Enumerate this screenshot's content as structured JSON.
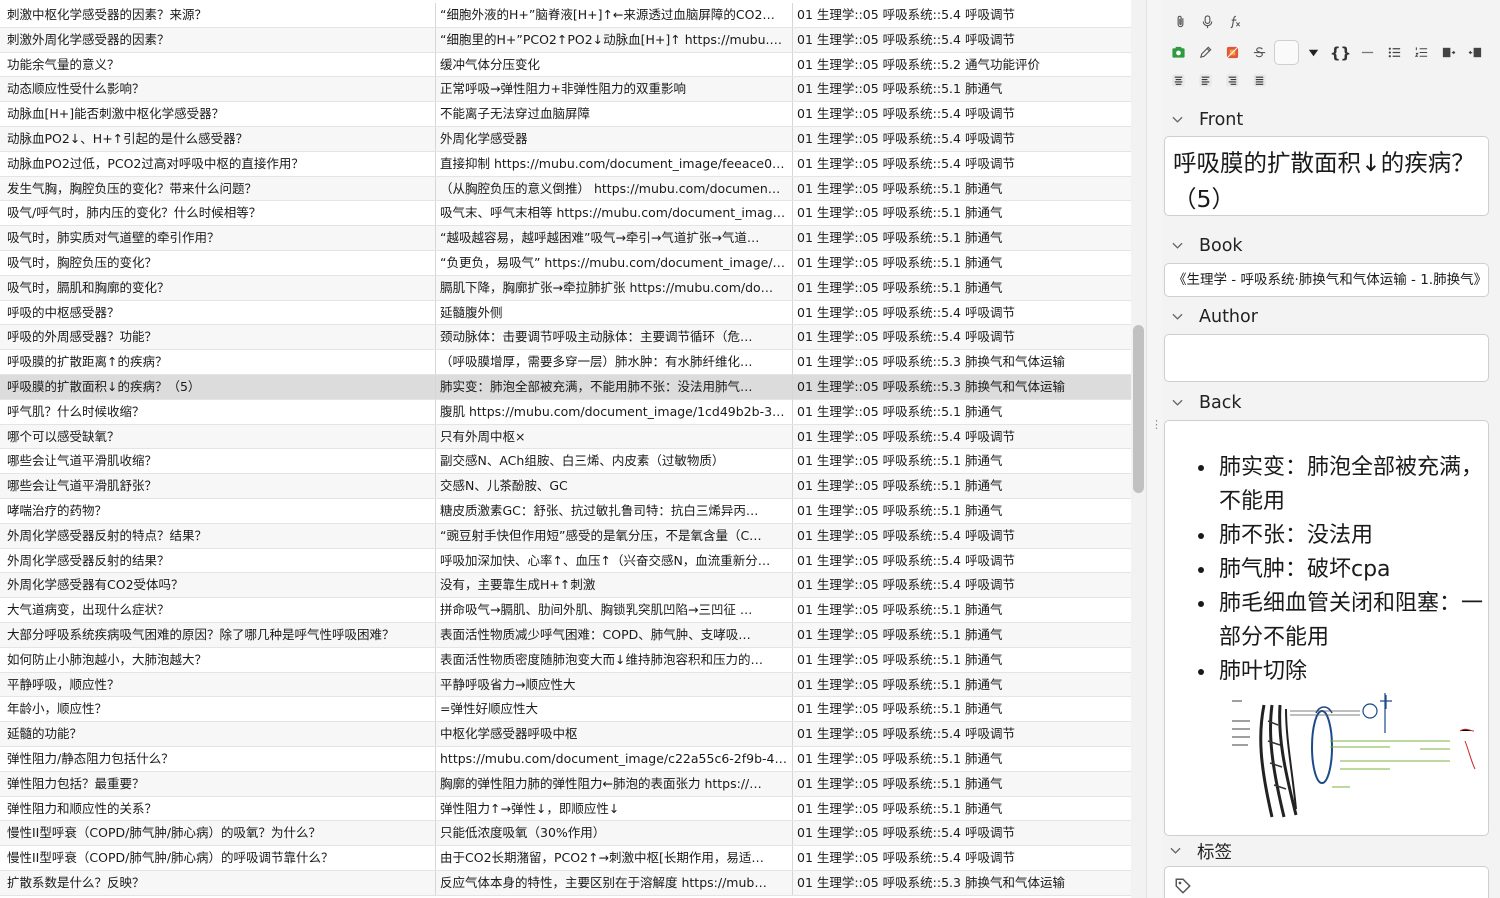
{
  "table": {
    "rows": [
      {
        "question": "刺激中枢化学感受器的因素？来源？",
        "answer": "“细胞外液的H+”脑脊液[H+]↑←来源透过血脑屏障的CO2…",
        "deck": "01 生理学::05 呼吸系统::5.4 呼吸调节"
      },
      {
        "question": "刺激外周化学感受器的因素？",
        "answer": "“细胞里的H+”PCO2↑PO2↓动脉血[H+]↑  https://mubu.co…",
        "deck": "01 生理学::05 呼吸系统::5.4 呼吸调节"
      },
      {
        "question": "功能余气量的意义？",
        "answer": "缓冲气体分压变化",
        "deck": "01 生理学::05 呼吸系统::5.2 通气功能评价"
      },
      {
        "question": "动态顺应性受什么影响？",
        "answer": "正常呼吸→弹性阻力+非弹性阻力的双重影响",
        "deck": "01 生理学::05 呼吸系统::5.1 肺通气"
      },
      {
        "question": "动脉血[H+]能否刺激中枢化学感受器？",
        "answer": "不能离子无法穿过血脑屏障",
        "deck": "01 生理学::05 呼吸系统::5.4 呼吸调节"
      },
      {
        "question": "动脉血PO2↓、H+↑引起的是什么感受器？",
        "answer": "外周化学感受器",
        "deck": "01 生理学::05 呼吸系统::5.4 呼吸调节"
      },
      {
        "question": "动脉血PO2过低，PCO2过高对呼吸中枢的直接作用？",
        "answer": "直接抑制  https://mubu.com/document_image/feeace02…",
        "deck": "01 生理学::05 呼吸系统::5.4 呼吸调节"
      },
      {
        "question": "发生气胸，胸腔负压的变化？带来什么问题？",
        "answer": "（从胸腔负压的意义倒推）  https://mubu.com/documen…",
        "deck": "01 生理学::05 呼吸系统::5.1 肺通气"
      },
      {
        "question": "吸气/呼气时，肺内压的变化？什么时候相等？",
        "answer": "吸气末、呼气末相等  https://mubu.com/document_imag…",
        "deck": "01 生理学::05 呼吸系统::5.1 肺通气"
      },
      {
        "question": "吸气时，肺实质对气道壁的牵引作用？",
        "answer": "“越吸越容易，越呼越困难”吸气→牵引→气道扩张→气道…",
        "deck": "01 生理学::05 呼吸系统::5.1 肺通气"
      },
      {
        "question": "吸气时，胸腔负压的变化？",
        "answer": "“负更负，易吸气”  https://mubu.com/document_image/c…",
        "deck": "01 生理学::05 呼吸系统::5.1 肺通气"
      },
      {
        "question": "吸气时，膈肌和胸廓的变化？",
        "answer": "膈肌下降，胸廓扩张→牵拉肺扩张  https://mubu.com/do…",
        "deck": "01 生理学::05 呼吸系统::5.1 肺通气"
      },
      {
        "question": "呼吸的中枢感受器？",
        "answer": "延髓腹外侧",
        "deck": "01 生理学::05 呼吸系统::5.4 呼吸调节"
      },
      {
        "question": "呼吸的外周感受器？功能？",
        "answer": "颈动脉体：击要调节呼吸主动脉体：主要调节循环（危…",
        "deck": "01 生理学::05 呼吸系统::5.4 呼吸调节"
      },
      {
        "question": "呼吸膜的扩散距离↑的疾病？",
        "answer": "（呼吸膜增厚，需要多穿一层）肺水肿：有水肺纤维化…",
        "deck": "01 生理学::05 呼吸系统::5.3 肺换气和气体运输"
      },
      {
        "question": "呼吸膜的扩散面积↓的疾病？（5）",
        "answer": "肺实变：肺泡全部被充满，不能用肺不张：没法用肺气…",
        "deck": "01 生理学::05 呼吸系统::5.3 肺换气和气体运输"
      },
      {
        "question": "呼气肌？什么时候收缩？",
        "answer": "腹肌  https://mubu.com/document_image/1cd49b2b-39…",
        "deck": "01 生理学::05 呼吸系统::5.1 肺通气"
      },
      {
        "question": "哪个可以感受缺氧？",
        "answer": "只有外周中枢×",
        "deck": "01 生理学::05 呼吸系统::5.4 呼吸调节"
      },
      {
        "question": "哪些会让气道平滑肌收缩？",
        "answer": "副交感N、ACh组胺、白三烯、内皮素（过敏物质）",
        "deck": "01 生理学::05 呼吸系统::5.1 肺通气"
      },
      {
        "question": "哪些会让气道平滑肌舒张？",
        "answer": "交感N、儿茶酚胺、GC",
        "deck": "01 生理学::05 呼吸系统::5.1 肺通气"
      },
      {
        "question": "哮喘治疗的药物？",
        "answer": "糖皮质激素GC：舒张、抗过敏扎鲁司特：抗白三烯异丙…",
        "deck": "01 生理学::05 呼吸系统::5.1 肺通气"
      },
      {
        "question": "外周化学感受器反射的特点？结果？",
        "answer": "“豌豆射手快但作用短”感受的是氧分压，不是氧含量（C…",
        "deck": "01 生理学::05 呼吸系统::5.4 呼吸调节"
      },
      {
        "question": "外周化学感受器反射的结果？",
        "answer": "呼吸加深加快、心率↑、血压↑（兴奋交感N，血流重新分…",
        "deck": "01 生理学::05 呼吸系统::5.4 呼吸调节"
      },
      {
        "question": "外周化学感受器有CO2受体吗？",
        "answer": "没有，主要靠生成H+↑刺激",
        "deck": "01 生理学::05 呼吸系统::5.4 呼吸调节"
      },
      {
        "question": "大气道病变，出现什么症状？",
        "answer": "拼命吸气→膈肌、肋间外肌、胸锁乳突肌凹陷→三凹征  …",
        "deck": "01 生理学::05 呼吸系统::5.1 肺通气"
      },
      {
        "question": "大部分呼吸系统疾病吸气困难的原因？除了哪几种是呼气性呼吸困难？",
        "answer": "表面活性物质减少呼气困难：COPD、肺气肿、支哮吸…",
        "deck": "01 生理学::05 呼吸系统::5.1 肺通气"
      },
      {
        "question": "如何防止小肺泡越小，大肺泡越大？",
        "answer": "表面活性物质密度随肺泡变大而↓维持肺泡容积和压力的…",
        "deck": "01 生理学::05 呼吸系统::5.1 肺通气"
      },
      {
        "question": "平静呼吸，顺应性？",
        "answer": "平静呼吸省力→顺应性大",
        "deck": "01 生理学::05 呼吸系统::5.1 肺通气"
      },
      {
        "question": "年龄小，顺应性？",
        "answer": "=弹性好顺应性大",
        "deck": "01 生理学::05 呼吸系统::5.1 肺通气"
      },
      {
        "question": "延髓的功能？",
        "answer": "中枢化学感受器呼吸中枢",
        "deck": "01 生理学::05 呼吸系统::5.4 呼吸调节"
      },
      {
        "question": "弹性阻力/静态阻力包括什么？",
        "answer": "https://mubu.com/document_image/c22a55c6-2f9b-438…",
        "deck": "01 生理学::05 呼吸系统::5.1 肺通气"
      },
      {
        "question": "弹性阻力包括？最重要？",
        "answer": "胸廓的弹性阻力肺的弹性阻力←肺泡的表面张力  https://…",
        "deck": "01 生理学::05 呼吸系统::5.1 肺通气"
      },
      {
        "question": "弹性阻力和顺应性的关系？",
        "answer": "弹性阻力↑→弹性↓，即顺应性↓",
        "deck": "01 生理学::05 呼吸系统::5.1 肺通气"
      },
      {
        "question": "慢性II型呼衰（COPD/肺气肿/肺心病）的吸氧？为什么？",
        "answer": "只能低浓度吸氧（30%作用）",
        "deck": "01 生理学::05 呼吸系统::5.4 呼吸调节"
      },
      {
        "question": "慢性II型呼衰（COPD/肺气肿/肺心病）的呼吸调节靠什么？",
        "answer": "由于CO2长期潴留，PCO2↑→刺激中枢[长期作用，易适…",
        "deck": "01 生理学::05 呼吸系统::5.4 呼吸调节"
      },
      {
        "question": "扩散系数是什么？反映？",
        "answer": "反应气体本身的特性，主要区别在于溶解度  https://mub…",
        "deck": "01 生理学::05 呼吸系统::5.3 肺换气和气体运输"
      }
    ],
    "selected_index": 15
  },
  "editor": {
    "toolbar_row1": [
      "paperclip-icon",
      "microphone-icon",
      "function-icon"
    ],
    "toolbar_row2": [
      "image-occlusion-icon",
      "pencil-icon",
      "color-picker-icon",
      "strikethrough-icon",
      "blank",
      "dropdown-arrow-icon",
      "curly-braces-icon",
      "horizontal-rule-icon",
      "bullet-list-icon",
      "numbered-list-icon",
      "indent-icon",
      "outdent-icon"
    ],
    "toolbar_row3": [
      "align-center-icon",
      "align-left-icon",
      "align-right-icon",
      "align-justify-icon"
    ],
    "front": {
      "label": "Front",
      "value": "呼吸膜的扩散面积↓的疾病？（5）"
    },
    "book": {
      "label": "Book",
      "value": "《生理学 - 呼吸系统·肺换气和气体运输 - 1.肺换气》"
    },
    "author": {
      "label": "Author",
      "value": ""
    },
    "back": {
      "label": "Back",
      "items": [
        "肺实变：肺泡全部被充满，不能用",
        "肺不张：没法用",
        "肺气肿：破坏cpa",
        "肺毛细血管关闭和阻塞：一部分不能用",
        "肺叶切除"
      ],
      "image_alt": "respiratory-membrane-diagram"
    },
    "tags": {
      "label": "标签",
      "value": ""
    },
    "colors": {
      "accent_green": "#2e9b3f",
      "selected_row": "#dcdcdc"
    }
  }
}
